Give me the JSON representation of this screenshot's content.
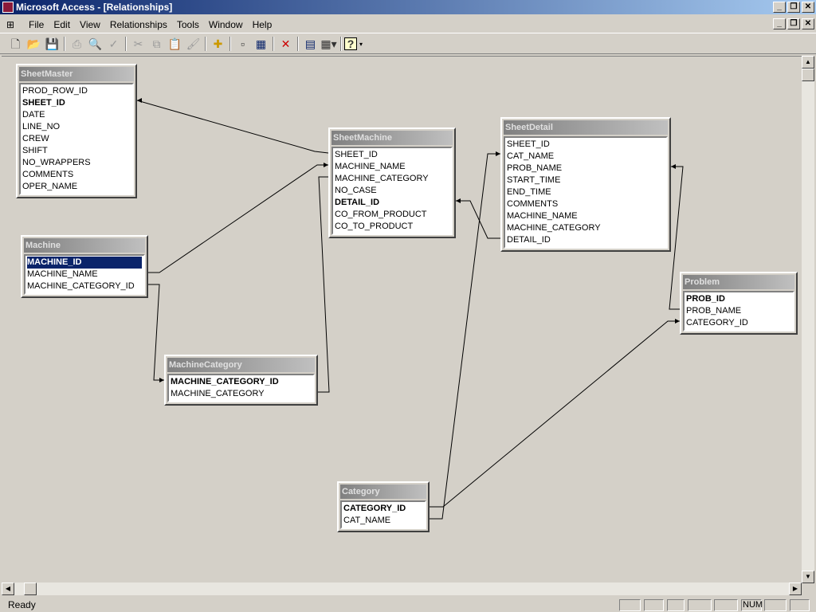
{
  "window": {
    "title": "Microsoft Access - [Relationships]"
  },
  "menu": [
    "File",
    "Edit",
    "View",
    "Relationships",
    "Tools",
    "Window",
    "Help"
  ],
  "toolbar": [
    "new",
    "open",
    "save",
    "print",
    "print-preview",
    "spelling",
    "cut",
    "copy",
    "paste",
    "format-painter",
    "show-table",
    "show-direct",
    "show-all",
    "delete",
    "database-window",
    "new-object",
    "help"
  ],
  "tables": [
    {
      "name": "SheetMaster",
      "fields": [
        "PROD_ROW_ID",
        "SHEET_ID",
        "DATE",
        "LINE_NO",
        "CREW",
        "SHIFT",
        "NO_WRAPPERS",
        "COMMENTS",
        "OPER_NAME"
      ],
      "keys": [
        "SHEET_ID"
      ]
    },
    {
      "name": "Machine",
      "fields": [
        "MACHINE_ID",
        "MACHINE_NAME",
        "MACHINE_CATEGORY_ID"
      ],
      "keys": [
        "MACHINE_ID"
      ],
      "selected": "MACHINE_ID"
    },
    {
      "name": "SheetMachine",
      "fields": [
        "SHEET_ID",
        "MACHINE_NAME",
        "MACHINE_CATEGORY",
        "NO_CASE",
        "DETAIL_ID",
        "CO_FROM_PRODUCT",
        "CO_TO_PRODUCT"
      ],
      "keys": [
        "DETAIL_ID"
      ]
    },
    {
      "name": "SheetDetail",
      "fields": [
        "SHEET_ID",
        "CAT_NAME",
        "PROB_NAME",
        "START_TIME",
        "END_TIME",
        "COMMENTS",
        "MACHINE_NAME",
        "MACHINE_CATEGORY",
        "DETAIL_ID"
      ],
      "keys": []
    },
    {
      "name": "Problem",
      "fields": [
        "PROB_ID",
        "PROB_NAME",
        "CATEGORY_ID"
      ],
      "keys": [
        "PROB_ID"
      ]
    },
    {
      "name": "MachineCategory",
      "fields": [
        "MACHINE_CATEGORY_ID",
        "MACHINE_CATEGORY"
      ],
      "keys": [
        "MACHINE_CATEGORY_ID"
      ]
    },
    {
      "name": "Category",
      "fields": [
        "CATEGORY_ID",
        "CAT_NAME"
      ],
      "keys": [
        "CATEGORY_ID"
      ]
    }
  ],
  "status": {
    "text": "Ready",
    "num": "NUM"
  }
}
